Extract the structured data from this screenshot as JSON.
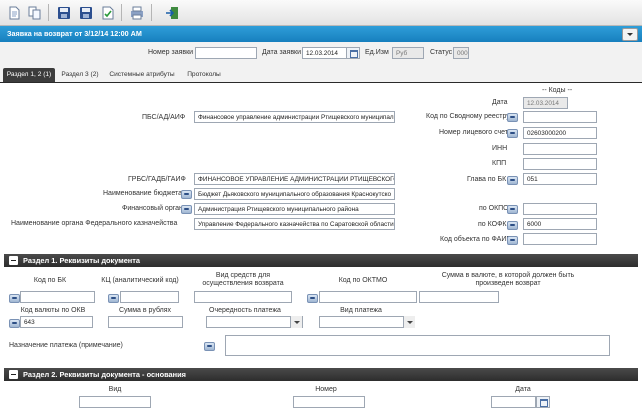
{
  "window": {
    "title": "Заявка на возврат от 3/12/14 12:00 AM"
  },
  "toolbar": {
    "buttons": [
      "new-document-icon",
      "copy-document-icon",
      "save-icon",
      "save-as-icon",
      "check-document-icon",
      "print-icon",
      "exit-icon"
    ]
  },
  "header": {
    "nomer_label": "Номер заявки",
    "nomer_value": "",
    "data_label": "Дата заявки",
    "data_value": "12.03.2014",
    "edizm_label": "Ед.Изм",
    "edizm_value": "Руб",
    "status_label": "Статус",
    "status_value": "000"
  },
  "tabs": [
    {
      "label": "Раздел 1, 2 (1)",
      "active": true
    },
    {
      "label": "Раздел 3 (2)"
    },
    {
      "label": "Системные атрибуты"
    },
    {
      "label": "Протоколы"
    }
  ],
  "form": {
    "codes_heading": "-- Коды --",
    "date_label": "Дата",
    "date_value": "12.03.2014",
    "pbs_label": "ПБС/АД/АИФ",
    "pbs_value": "Финансовое управление администрации Ртищевского муниципаль",
    "svod_label": "Код по Сводному реестру",
    "svod_value": "",
    "licschet_label": "Номер лицевого счета",
    "licschet_value": "02603000200",
    "inn_label": "ИНН",
    "inn_value": "",
    "kpp_label": "КПП",
    "kpp_value": "",
    "grbs_label": "ГРБС/ГАДБ/ГАИФ",
    "grbs_value": "ФИНАНСОВОЕ УПРАВЛЕНИЕ АДМИНИСТРАЦИИ РТИЩЕВСКОГО",
    "glava_label": "Глава по БК",
    "glava_value": "051",
    "budget_label": "Наименование бюджета",
    "budget_value": "Бюджет Дьяковского муниципального образования Краснокутско",
    "finorg_label": "Финансовый орган",
    "finorg_value": "Администрация Ртищевского муниципального района",
    "okpo_label": "по ОКПО",
    "okpo_value": "",
    "fk_label": "Наименование органа Федерального казначейства",
    "fk_value": "Управление Федерального казначейства по Саратовской области",
    "kofk_label": "по КОФК",
    "kofk_value": "6000",
    "faip_label": "Код объекта по ФАИП",
    "faip_value": ""
  },
  "section1": {
    "title": "Раздел 1. Реквизиты документа",
    "kod_bk_label": "Код по БК",
    "kod_bk_value": "",
    "kc_label": "КЦ (аналитический код)",
    "kc_value": "",
    "vid_sredstv_label": "Вид средств для осуществления возврата",
    "vid_sredstv_value": "",
    "oktmo_label": "Код по ОКТМО",
    "oktmo_value": "",
    "summa_val_label": "Сумма в валюте, в которой должен быть произведен возврат",
    "summa_val_value": "",
    "okv_label": "Код валюты по ОКВ",
    "okv_value": "643",
    "summa_rub_label": "Сумма в рублях",
    "summa_rub_value": "",
    "ochered_label": "Очередность платежа",
    "ochered_value": "",
    "vid_plat_label": "Вид платежа",
    "vid_plat_value": "",
    "naznach_label": "Назначение платежа (примечание)",
    "naznach_value": ""
  },
  "section2": {
    "title": "Раздел 2. Реквизиты документа - основания",
    "vid_label": "Вид",
    "vid_value": "",
    "nomer_label": "Номер",
    "nomer_value": "",
    "data_label": "Дата",
    "data_value": ""
  },
  "colors": {
    "titlebar": "#1f8dcb",
    "section_header": "#363636",
    "active_tab": "#3c3c3c"
  }
}
